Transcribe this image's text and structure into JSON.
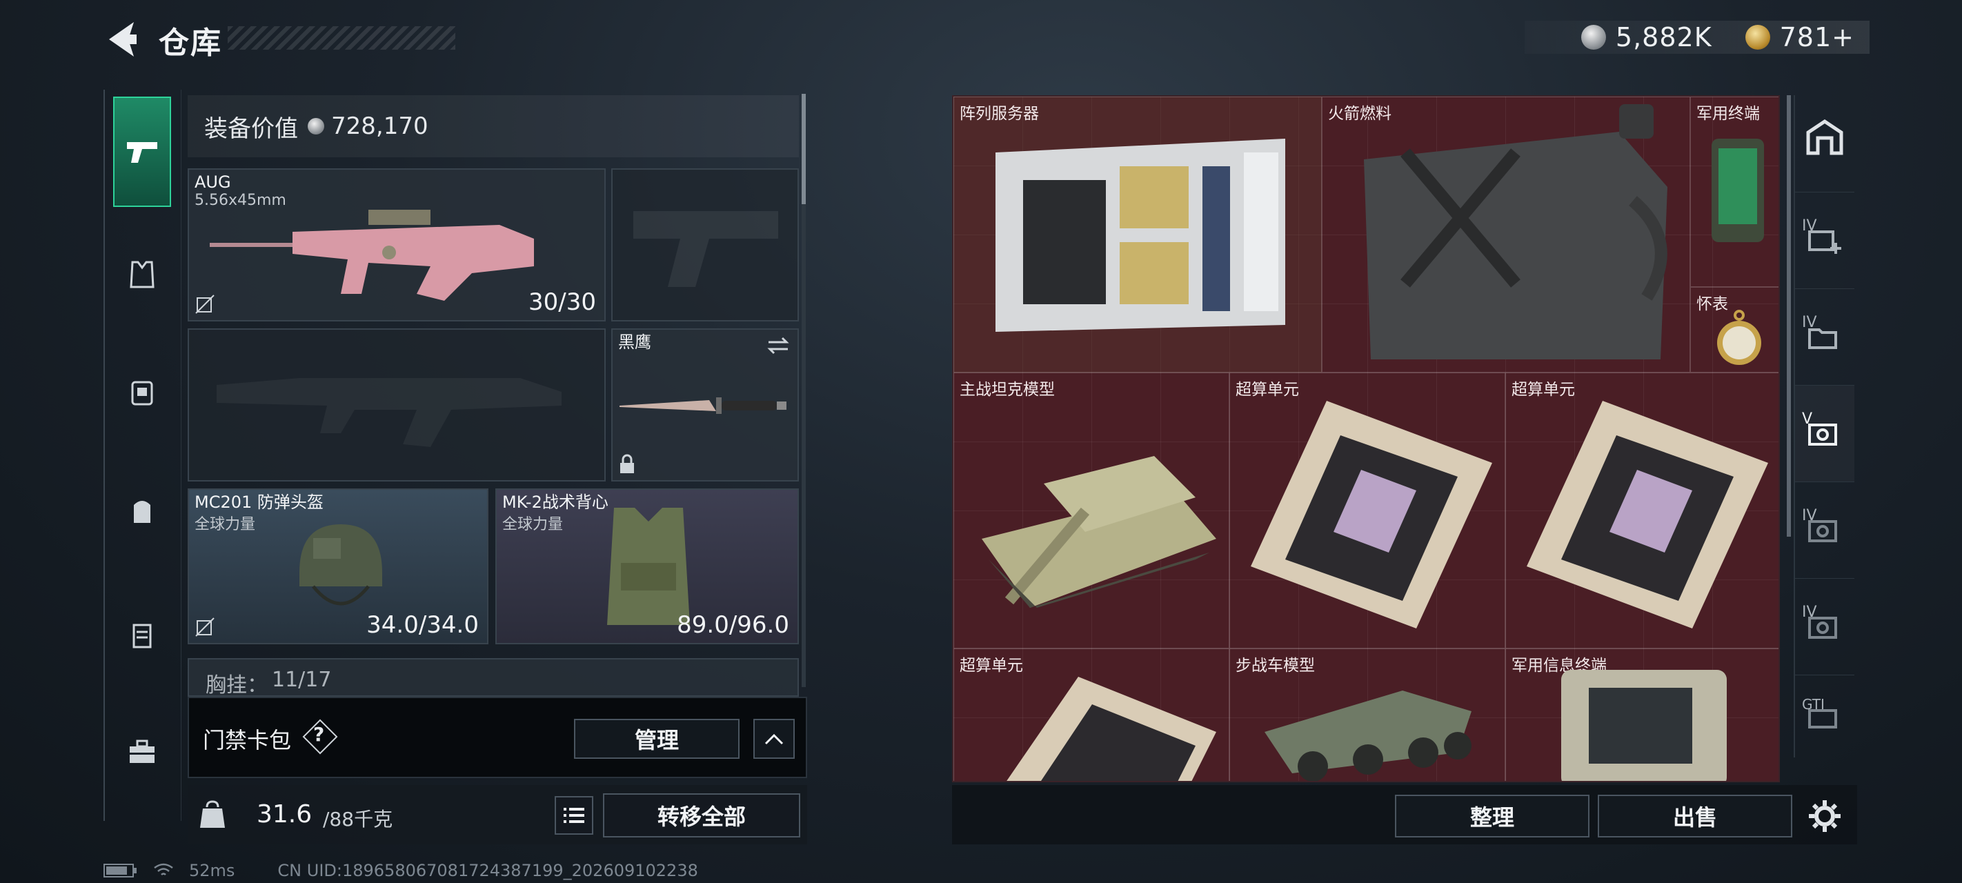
{
  "header": {
    "title": "仓库"
  },
  "currency": {
    "silver": "5,882K",
    "gold": "781+"
  },
  "equipment": {
    "value_label": "装备价值",
    "value": "728,170",
    "primary_weapon": {
      "name": "AUG",
      "caliber": "5.56x45mm",
      "ammo": "30/30"
    },
    "melee": {
      "name": "黑鹰"
    },
    "helmet": {
      "name": "MC201 防弹头盔",
      "brand": "全球力量",
      "durability": "34.0/34.0"
    },
    "armor": {
      "name": "MK-2战术背心",
      "brand": "全球力量",
      "durability": "89.0/96.0"
    },
    "chest_rig": {
      "label": "胸挂：",
      "capacity": "11/17"
    }
  },
  "card_pack": {
    "label": "门禁卡包",
    "help": "?",
    "manage_button": "管理"
  },
  "weight": {
    "current": "31.6",
    "max": "/88千克"
  },
  "transfer_all_button": "转移全部",
  "storage": {
    "items": [
      {
        "name": "阵列服务器"
      },
      {
        "name": "火箭燃料"
      },
      {
        "name": "军用终端"
      },
      {
        "name": "怀表"
      },
      {
        "name": "主战坦克模型"
      },
      {
        "name": "超算单元"
      },
      {
        "name": "超算单元"
      },
      {
        "name": "超算单元"
      },
      {
        "name": "步战车模型"
      },
      {
        "name": "军用信息终端"
      }
    ],
    "tidy_button": "整理",
    "sell_button": "出售"
  },
  "right_rail": {
    "tabs": [
      "IV",
      "IV",
      "V",
      "IV",
      "IV",
      "GTI"
    ]
  },
  "status": {
    "ping": "52ms",
    "uid": "CN UID:18965806708172438719​9_202609102238"
  },
  "colors": {
    "accent_green": "#2ed39a",
    "storage_bg": "#4a1e25"
  }
}
